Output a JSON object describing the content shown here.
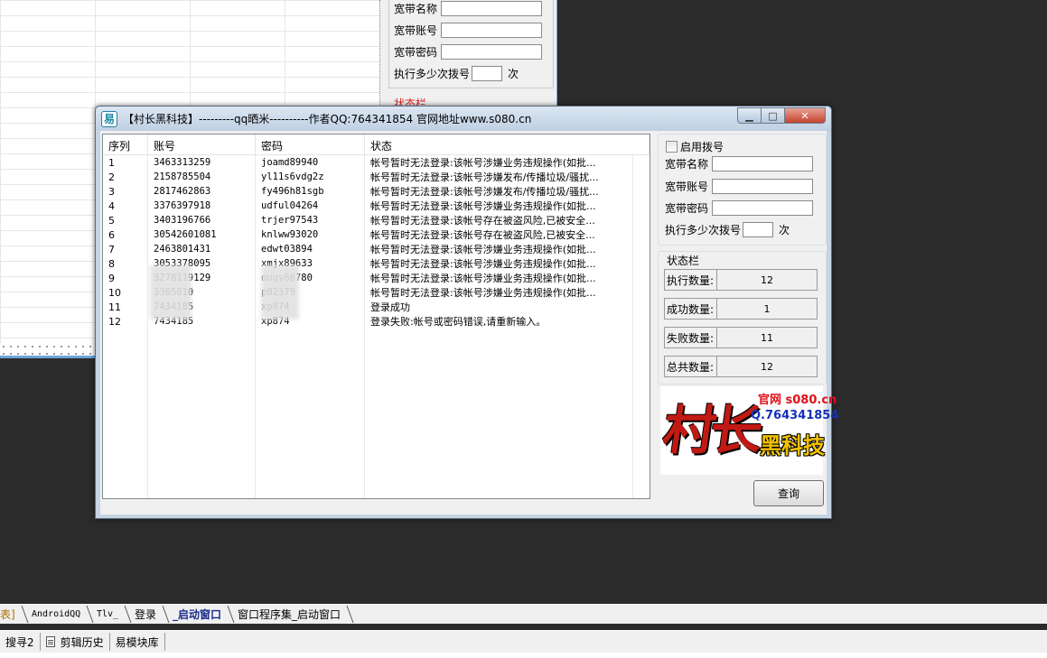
{
  "bg_form": {
    "name_label": "宽带名称",
    "account_label": "宽带账号",
    "password_label": "宽带密码",
    "retry_label": "执行多少次拨号",
    "retry_unit": "次",
    "status_partial": "状态栏"
  },
  "window": {
    "title": "【村长黑科技】---------qq晒米----------作者QQ:764341854   官网地址www.s080.cn",
    "min": "▁",
    "max": "□",
    "close": "✕"
  },
  "list": {
    "headers": [
      "序列",
      "账号",
      "密码",
      "状态"
    ],
    "rows": [
      [
        "1",
        "3463313259",
        "joamd89940",
        "帐号暂时无法登录:该帐号涉嫌业务违规操作(如批..."
      ],
      [
        "2",
        "2158785504",
        "yl11s6vdg2z",
        "帐号暂时无法登录:该帐号涉嫌发布/传播垃圾/骚扰..."
      ],
      [
        "3",
        "2817462863",
        "fy496h81sgb",
        "帐号暂时无法登录:该帐号涉嫌发布/传播垃圾/骚扰..."
      ],
      [
        "4",
        "3376397918",
        "udful04264",
        "帐号暂时无法登录:该帐号涉嫌业务违规操作(如批..."
      ],
      [
        "5",
        "3403196766",
        "trjer97543",
        "帐号暂时无法登录:该帐号存在被盗风险,已被安全..."
      ],
      [
        "6",
        "30542601081",
        "knlww93020",
        "帐号暂时无法登录:该帐号存在被盗风险,已被安全..."
      ],
      [
        "7",
        "2463801431",
        "edwt03894",
        "帐号暂时无法登录:该帐号涉嫌业务违规操作(如批..."
      ],
      [
        "8",
        "3053378095",
        "xmjx89633",
        "帐号暂时无法登录:该帐号涉嫌业务违规操作(如批..."
      ],
      [
        "9",
        "3278119129",
        "ouqy86780",
        "帐号暂时无法登录:该帐号涉嫌业务违规操作(如批..."
      ],
      [
        "10",
        "3365810",
        "p02379",
        "帐号暂时无法登录:该帐号涉嫌业务违规操作(如批..."
      ],
      [
        "11",
        "7434185",
        "xp874",
        "登录成功"
      ],
      [
        "12",
        "7434185",
        "xp874",
        "登录失败:帐号或密码错误,请重新输入。"
      ]
    ]
  },
  "panel": {
    "enable_dial": "启用拨号",
    "name_label": "宽带名称",
    "account_label": "宽带账号",
    "password_label": "宽带密码",
    "retry_label": "执行多少次拨号",
    "retry_unit": "次",
    "status_title": "状态栏",
    "stats": [
      {
        "label": "执行数量:",
        "value": "12"
      },
      {
        "label": "成功数量:",
        "value": "1"
      },
      {
        "label": "失败数量:",
        "value": "11"
      },
      {
        "label": "总共数量:",
        "value": "12"
      }
    ],
    "logo": {
      "big": "村长",
      "site": "官网 s080.cn",
      "qq": "Q.764341854",
      "brand": "黑科技"
    },
    "query": "查询"
  },
  "tabs": [
    "表]",
    "AndroidQQ",
    "Tlv_",
    "登录",
    "_启动窗口",
    "窗口程序集_启动窗口"
  ],
  "toolbar": [
    "搜寻2",
    "剪辑历史",
    "易模块库"
  ]
}
